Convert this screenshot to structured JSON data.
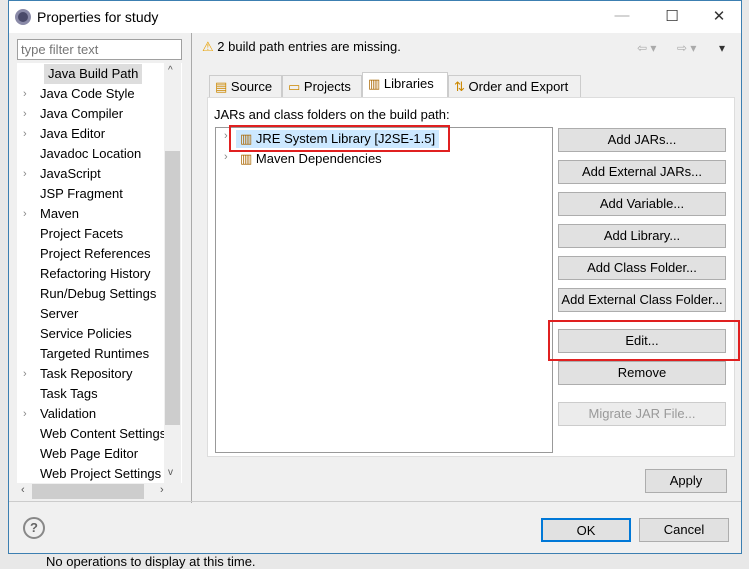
{
  "window": {
    "title": "Properties for study",
    "minimize": "—",
    "maximize": "☐",
    "close": "✕"
  },
  "sidebar": {
    "filter_placeholder": "type filter text",
    "items": [
      {
        "label": "Java Build Path",
        "expandable": false,
        "selected": true
      },
      {
        "label": "Java Code Style",
        "expandable": true
      },
      {
        "label": "Java Compiler",
        "expandable": true
      },
      {
        "label": "Java Editor",
        "expandable": true
      },
      {
        "label": "Javadoc Location",
        "expandable": false
      },
      {
        "label": "JavaScript",
        "expandable": true
      },
      {
        "label": "JSP Fragment",
        "expandable": false
      },
      {
        "label": "Maven",
        "expandable": true
      },
      {
        "label": "Project Facets",
        "expandable": false
      },
      {
        "label": "Project References",
        "expandable": false
      },
      {
        "label": "Refactoring History",
        "expandable": false
      },
      {
        "label": "Run/Debug Settings",
        "expandable": false
      },
      {
        "label": "Server",
        "expandable": false
      },
      {
        "label": "Service Policies",
        "expandable": false
      },
      {
        "label": "Targeted Runtimes",
        "expandable": false
      },
      {
        "label": "Task Repository",
        "expandable": true
      },
      {
        "label": "Task Tags",
        "expandable": false
      },
      {
        "label": "Validation",
        "expandable": true
      },
      {
        "label": "Web Content Settings",
        "expandable": false
      },
      {
        "label": "Web Page Editor",
        "expandable": false
      },
      {
        "label": "Web Project Settings",
        "expandable": false
      }
    ]
  },
  "main": {
    "message": "2 build path entries are missing.",
    "tabs": [
      {
        "label": "Source"
      },
      {
        "label": "Projects"
      },
      {
        "label": "Libraries",
        "active": true
      },
      {
        "label": "Order and Export"
      }
    ],
    "list_label": "JARs and class folders on the build path:",
    "entries": [
      {
        "label": "JRE System Library [J2SE-1.5]",
        "selected": true
      },
      {
        "label": "Maven Dependencies"
      }
    ],
    "buttons": [
      "Add JARs...",
      "Add External JARs...",
      "Add Variable...",
      "Add Library...",
      "Add Class Folder...",
      "Add External Class Folder..."
    ],
    "edit": "Edit...",
    "remove": "Remove",
    "migrate": "Migrate JAR File...",
    "apply": "Apply"
  },
  "footer": {
    "ok": "OK",
    "cancel": "Cancel",
    "help": "?"
  },
  "background_text": "No operations to display at this time.",
  "colors": {
    "highlight": "#e02020",
    "accent": "#3c7fb1"
  }
}
